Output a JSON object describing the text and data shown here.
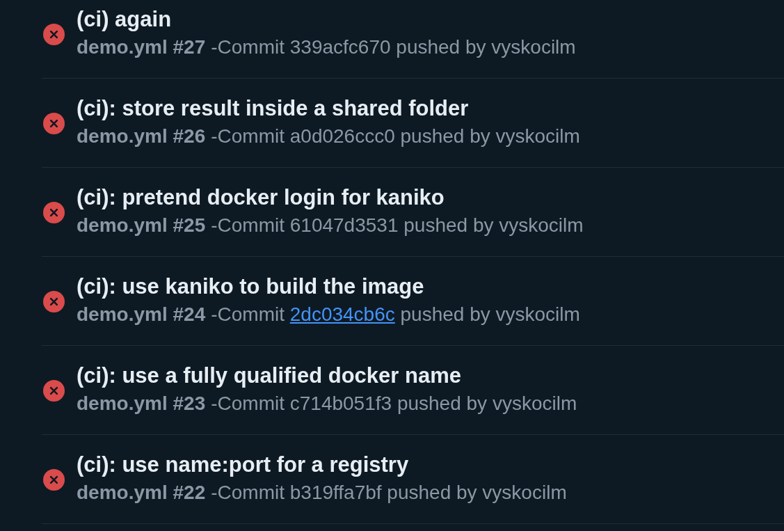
{
  "runs": [
    {
      "kind": "failure",
      "title": "(ci) again",
      "workflow": "demo.yml #27",
      "prefix": "-Commit",
      "commit": "339acfc670",
      "commit_hovered": false,
      "suffix": "pushed by vyskocilm"
    },
    {
      "kind": "failure",
      "title": "(ci): store result inside a shared folder",
      "workflow": "demo.yml #26",
      "prefix": "-Commit",
      "commit": "a0d026ccc0",
      "commit_hovered": false,
      "suffix": "pushed by vyskocilm"
    },
    {
      "kind": "failure",
      "title": "(ci): pretend docker login for kaniko",
      "workflow": "demo.yml #25",
      "prefix": "-Commit",
      "commit": "61047d3531",
      "commit_hovered": false,
      "suffix": "pushed by vyskocilm"
    },
    {
      "kind": "failure",
      "title": "(ci): use kaniko to build the image",
      "workflow": "demo.yml #24",
      "prefix": "-Commit",
      "commit": "2dc034cb6c",
      "commit_hovered": true,
      "suffix": "pushed by vyskocilm"
    },
    {
      "kind": "failure",
      "title": "(ci): use a fully qualified docker name",
      "workflow": "demo.yml #23",
      "prefix": "-Commit",
      "commit": "c714b051f3",
      "commit_hovered": false,
      "suffix": "pushed by vyskocilm"
    },
    {
      "kind": "failure",
      "title": "(ci): use name:port for a registry",
      "workflow": "demo.yml #22",
      "prefix": "-Commit",
      "commit": "b319ffa7bf",
      "commit_hovered": false,
      "suffix": "pushed by vyskocilm"
    }
  ]
}
